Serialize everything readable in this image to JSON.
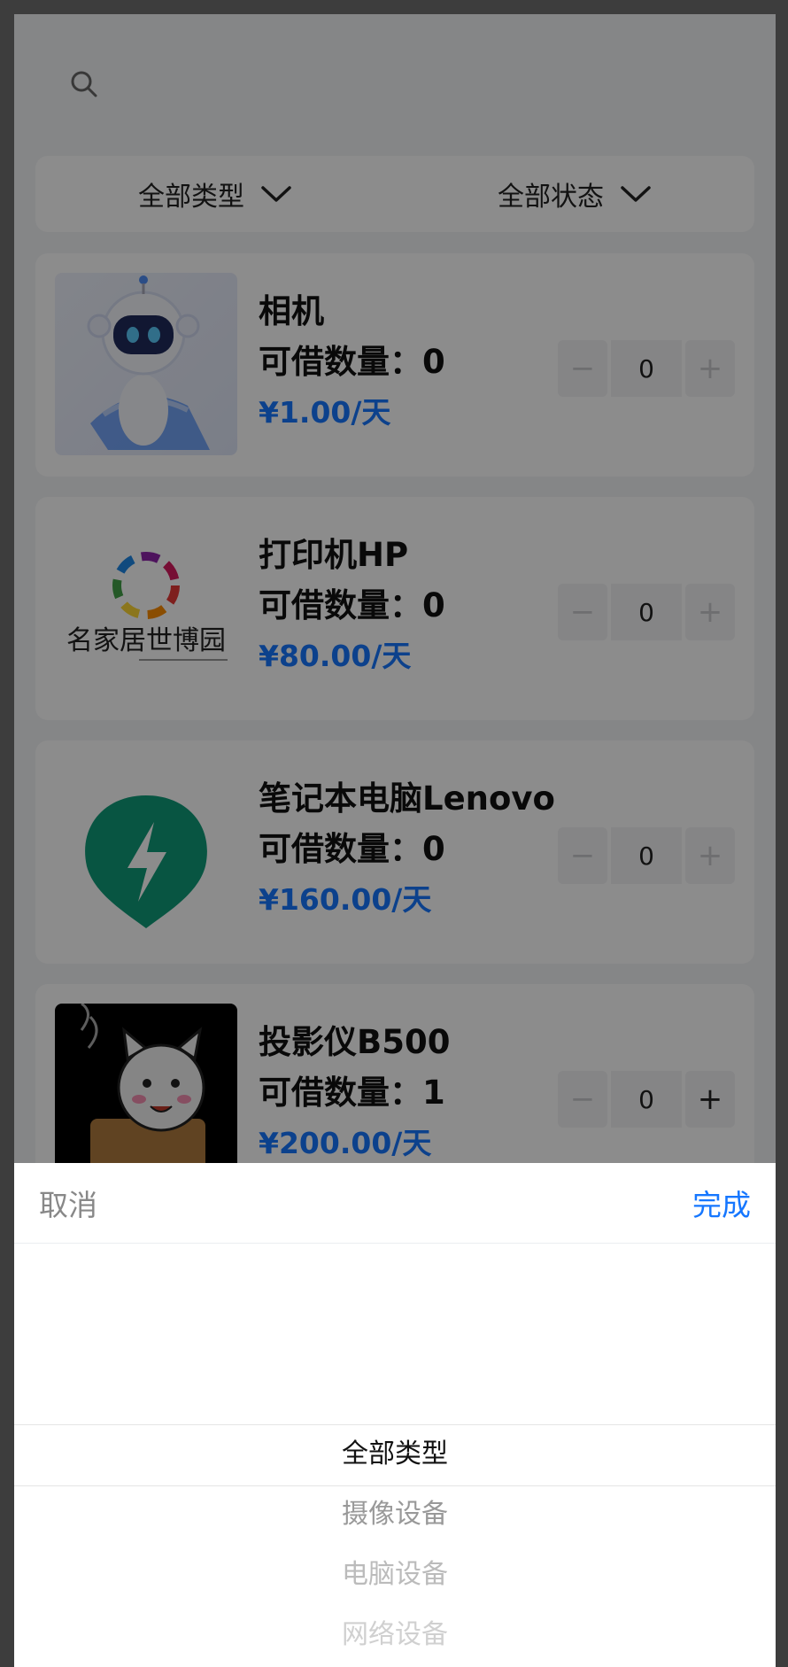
{
  "filters": {
    "type_label": "全部类型",
    "status_label": "全部状态"
  },
  "items": [
    {
      "name": "相机",
      "qty_label": "可借数量：0",
      "price": "¥1.00/天",
      "count": "0"
    },
    {
      "name": "打印机HP",
      "qty_label": "可借数量：0",
      "price": "¥80.00/天",
      "count": "0",
      "logo_text": "名家居世博园"
    },
    {
      "name": "笔记本电脑Lenovo",
      "qty_label": "可借数量：0",
      "price": "¥160.00/天",
      "count": "0"
    },
    {
      "name": "投影仪B500",
      "qty_label": "可借数量：1",
      "price": "¥200.00/天",
      "count": "0"
    }
  ],
  "stepper": {
    "minus": "−",
    "plus": "+"
  },
  "picker": {
    "cancel_label": "取消",
    "done_label": "完成",
    "options": [
      "全部类型",
      "摄像设备",
      "电脑设备",
      "网络设备"
    ]
  },
  "colors": {
    "accent": "#1677ff",
    "price": "#1677ff",
    "overlay": "rgba(0,0,0,0.45)"
  },
  "icons": {
    "search": "search-icon",
    "dropdown": "chevron-down-icon"
  }
}
